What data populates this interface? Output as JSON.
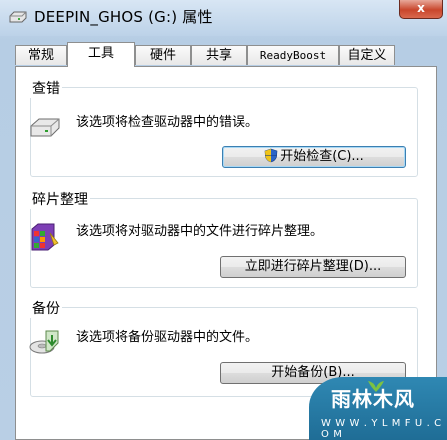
{
  "window": {
    "title": "DEEPIN_GHOS (G:) 属性",
    "close_label": "x"
  },
  "tabs": [
    {
      "label": "常规",
      "active": false
    },
    {
      "label": "工具",
      "active": true
    },
    {
      "label": "硬件",
      "active": false
    },
    {
      "label": "共享",
      "active": false
    },
    {
      "label": "ReadyBoost",
      "active": false
    },
    {
      "label": "自定义",
      "active": false
    }
  ],
  "groups": {
    "error_check": {
      "title": "查错",
      "description": "该选项将检查驱动器中的错误。",
      "button": "开始检查(C)...",
      "icon": "drive-icon"
    },
    "defrag": {
      "title": "碎片整理",
      "description": "该选项将对驱动器中的文件进行碎片整理。",
      "button": "立即进行碎片整理(D)...",
      "icon": "defrag-icon"
    },
    "backup": {
      "title": "备份",
      "description": "该选项将备份驱动器中的文件。",
      "button": "开始备份(B)...",
      "icon": "backup-icon"
    }
  },
  "watermark": {
    "main": "雨林木风",
    "url": "W W W . Y L M F U . C O M"
  }
}
